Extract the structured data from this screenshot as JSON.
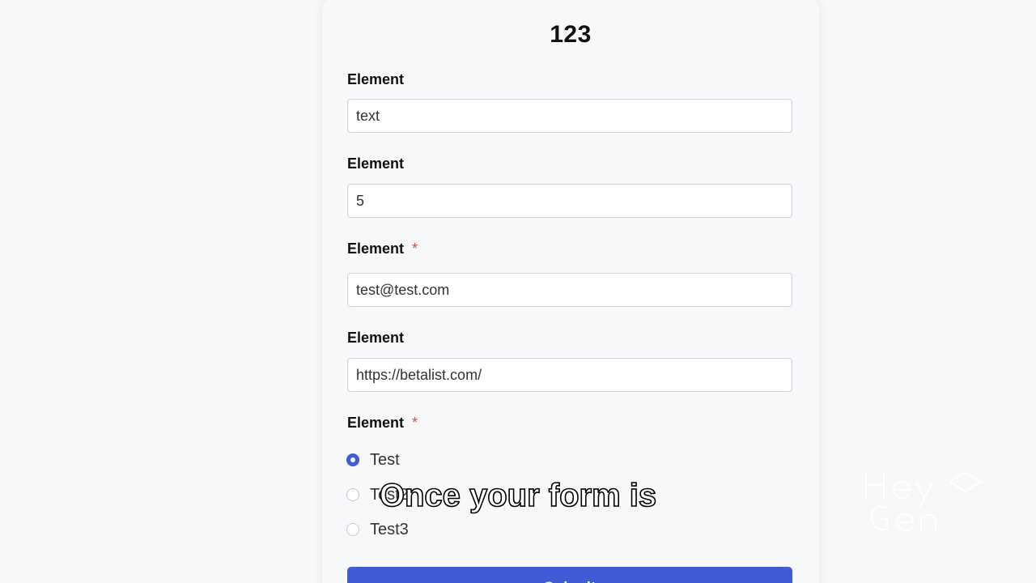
{
  "form": {
    "title": "123",
    "fields": [
      {
        "label": "Element",
        "required": false,
        "value": "text"
      },
      {
        "label": "Element",
        "required": false,
        "value": "5"
      },
      {
        "label": "Element",
        "required": true,
        "value": "test@test.com"
      },
      {
        "label": "Element",
        "required": false,
        "value": "https://betalist.com/"
      }
    ],
    "radio_group": {
      "label": "Element",
      "required": true,
      "options": [
        {
          "label": "Test",
          "checked": true
        },
        {
          "label": "Test2",
          "checked": false
        },
        {
          "label": "Test3",
          "checked": false
        }
      ]
    },
    "required_marker": "*",
    "submit_label": "Submit"
  },
  "overlay": {
    "subtitle": "Once your form is",
    "watermark_text": "HeyGen"
  },
  "colors": {
    "accent": "#3f5bd6",
    "required": "#d44b4b",
    "background": "#f7f8fa"
  }
}
